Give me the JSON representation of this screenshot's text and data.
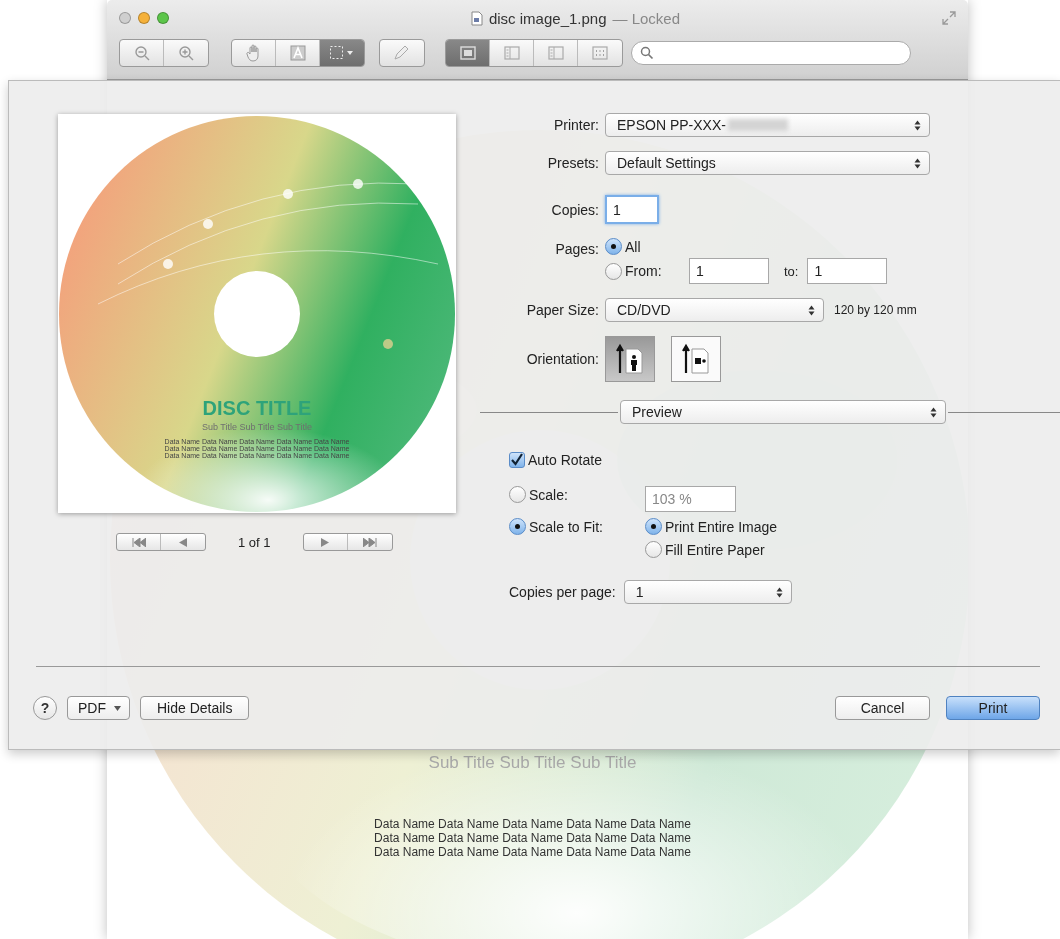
{
  "window": {
    "title": "disc image_1.png",
    "status": "— Locked"
  },
  "toolbar_groups": [
    [
      {
        "kind": "zoom-out",
        "selected": false
      },
      {
        "kind": "zoom-in",
        "selected": false
      }
    ],
    [
      {
        "kind": "hand",
        "selected": false
      },
      {
        "kind": "text",
        "selected": false
      },
      {
        "kind": "select",
        "selected": true
      }
    ],
    [
      {
        "kind": "pencil",
        "selected": false
      }
    ],
    [
      {
        "kind": "content",
        "selected": true
      },
      {
        "kind": "thumbnails",
        "selected": false
      },
      {
        "kind": "toc",
        "selected": false
      },
      {
        "kind": "contact-sheet",
        "selected": false
      }
    ]
  ],
  "document": {
    "subtitle": "Sub Title Sub Title Sub Title",
    "data_lines": [
      "Data Name Data Name Data Name Data Name Data Name",
      "Data Name Data Name Data Name Data Name Data Name",
      "Data Name Data Name Data Name Data Name Data Name"
    ]
  },
  "preview": {
    "title": "DISC TITLE",
    "subtitle": "Sub Title Sub Title Sub Title",
    "data_lines": [
      "Data Name Data Name Data Name Data Name Data Name",
      "Data Name Data Name Data Name Data Name Data Name",
      "Data Name Data Name Data Name Data Name Data Name"
    ],
    "page_indicator": "1 of 1"
  },
  "print": {
    "printer": {
      "label": "Printer:",
      "value": "EPSON PP-XXX-"
    },
    "presets": {
      "label": "Presets:",
      "value": "Default Settings"
    },
    "copies": {
      "label": "Copies:",
      "value": "1"
    },
    "pages": {
      "label": "Pages:",
      "options": [
        {
          "label": "All",
          "selected": true
        },
        {
          "label": "From:",
          "selected": false
        }
      ],
      "from": "1",
      "to_label": "to:",
      "to": "1"
    },
    "paper_size": {
      "label": "Paper Size:",
      "value": "CD/DVD",
      "note": "120 by 120 mm"
    },
    "orientation": {
      "label": "Orientation:",
      "options": [
        {
          "kind": "portrait",
          "selected": true
        },
        {
          "kind": "landscape",
          "selected": false
        }
      ]
    },
    "section": "Preview",
    "auto_rotate": {
      "label": "Auto Rotate",
      "checked": true
    },
    "scale": {
      "label": "Scale:",
      "selected": false,
      "value": "103 %"
    },
    "scale_to_fit": {
      "label": "Scale to Fit:",
      "selected": true,
      "options": [
        {
          "label": "Print Entire Image",
          "selected": true
        },
        {
          "label": "Fill Entire Paper",
          "selected": false
        }
      ]
    },
    "copies_per_page": {
      "label": "Copies per page:",
      "value": "1"
    }
  },
  "footer": {
    "help": "?",
    "pdf": "PDF",
    "hide_details": "Hide Details",
    "cancel": "Cancel",
    "print": "Print"
  }
}
